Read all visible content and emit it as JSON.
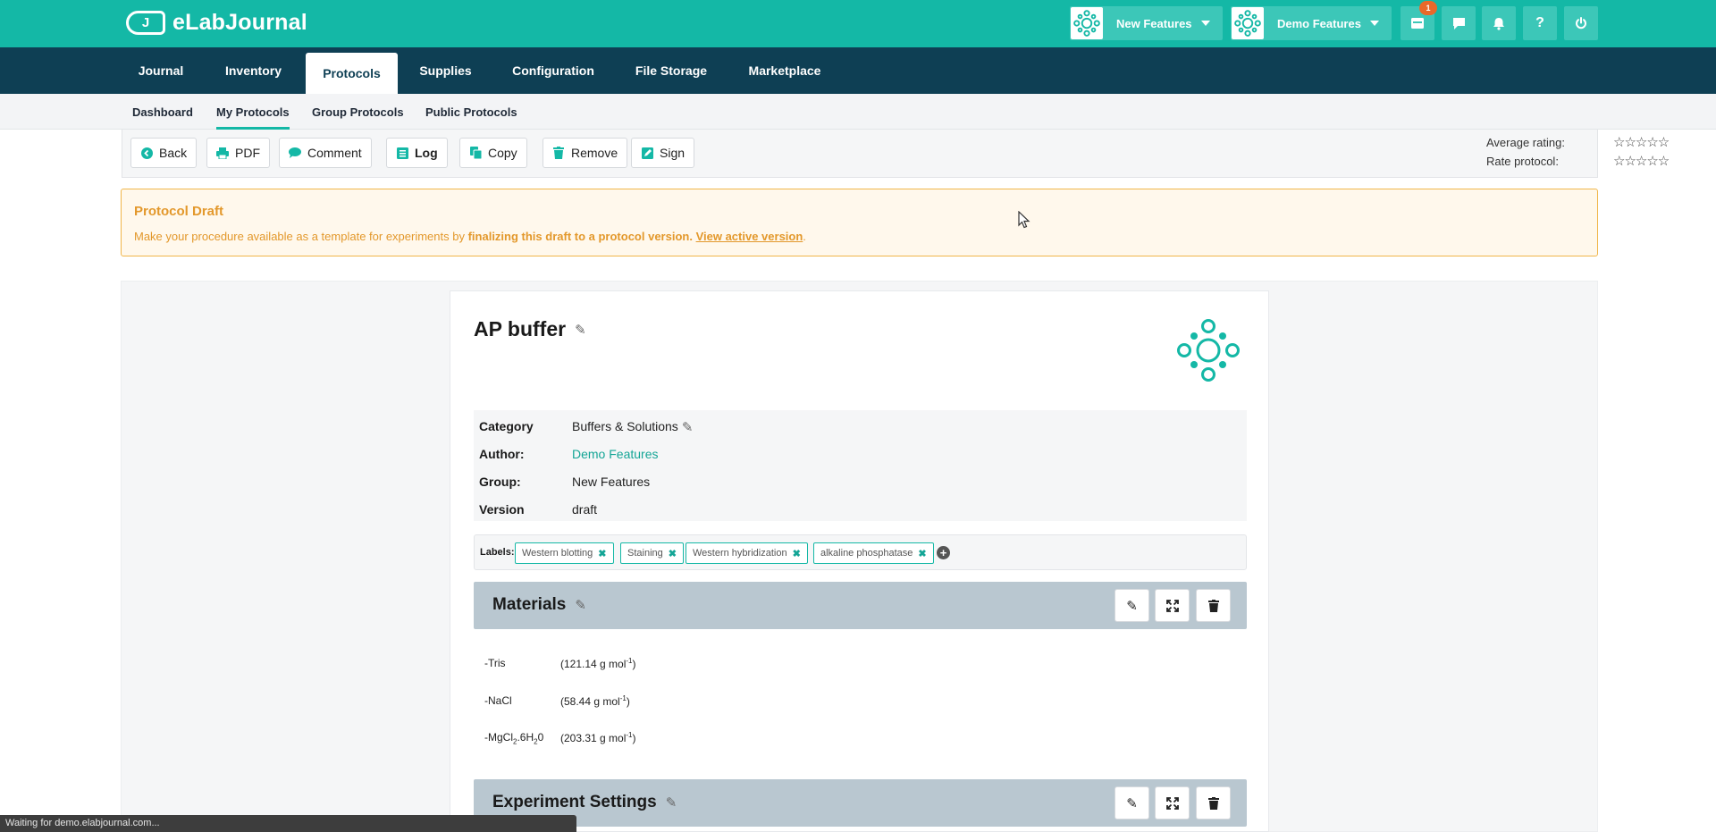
{
  "app": {
    "logo_mark": "J",
    "logo_text": "eLabJournal"
  },
  "topbar": {
    "workspaces": [
      {
        "label": "New Features"
      },
      {
        "label": "Demo Features"
      }
    ],
    "notification_count": "1",
    "help_label": "?"
  },
  "mainnav": {
    "items": [
      {
        "label": "Journal"
      },
      {
        "label": "Inventory"
      },
      {
        "label": "Protocols"
      },
      {
        "label": "Supplies"
      },
      {
        "label": "Configuration"
      },
      {
        "label": "File Storage"
      },
      {
        "label": "Marketplace"
      }
    ],
    "active": "Protocols"
  },
  "subnav": {
    "items": [
      {
        "label": "Dashboard"
      },
      {
        "label": "My Protocols"
      },
      {
        "label": "Group Protocols"
      },
      {
        "label": "Public Protocols"
      }
    ],
    "active": "My Protocols"
  },
  "toolbar": {
    "back": "Back",
    "pdf": "PDF",
    "comment": "Comment",
    "log": "Log",
    "copy": "Copy",
    "remove": "Remove",
    "sign": "Sign",
    "average_rating_label": "Average rating:",
    "rate_protocol_label": "Rate protocol:",
    "average_rating_stars": "☆☆☆☆☆",
    "rate_protocol_stars": "☆☆☆☆☆"
  },
  "draft_banner": {
    "title": "Protocol Draft",
    "text_prefix": "Make your procedure available as a template for experiments by ",
    "text_bold": "finalizing this draft to a protocol version.",
    "text_link": "View active version",
    "text_suffix": "."
  },
  "protocol": {
    "title": "AP buffer",
    "meta": [
      {
        "key": "Category",
        "value": "Buffers & Solutions"
      },
      {
        "key": "Author:",
        "value": "Demo Features"
      },
      {
        "key": "Group:",
        "value": "New Features"
      },
      {
        "key": "Version",
        "value": "draft"
      }
    ],
    "labels_title": "Labels:",
    "labels": [
      "Western blotting",
      "Staining",
      "Western hybridization",
      "alkaline phosphatase"
    ]
  },
  "sections": [
    {
      "title": "Materials"
    },
    {
      "title": "Experiment Settings"
    }
  ],
  "materials": [
    {
      "name": "-Tris",
      "amount": "(121.14 g mol",
      "exp": "-1",
      "close": ")"
    },
    {
      "name": "-NaCl",
      "amount": "(58.44 g mol",
      "exp": "-1",
      "close": ")"
    },
    {
      "name_prefix": "-MgCl",
      "name_sub1": "2",
      "name_mid": ".6H",
      "name_sub2": "2",
      "name_suffix": "0",
      "amount": "(203.31 g mol",
      "exp": "-1",
      "close": ")"
    }
  ],
  "status_bar": "Waiting for demo.elabjournal.com...",
  "colors": {
    "primary": "#14b8a6",
    "navy": "#0e3f54",
    "warning": "#e3982b",
    "section": "#b9c7d0"
  },
  "icons": [
    "logo-icon",
    "workspace-icon",
    "inbox-icon",
    "chat-icon",
    "bell-icon",
    "help-icon",
    "power-icon",
    "back-icon",
    "print-icon",
    "comment-icon",
    "log-icon",
    "copy-icon",
    "trash-icon",
    "sign-icon",
    "pencil-icon",
    "expand-icon",
    "plus-circle-icon"
  ]
}
